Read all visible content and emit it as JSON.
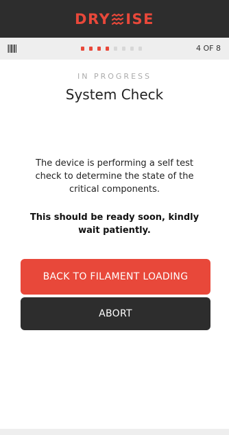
{
  "header": {
    "brand_left": "DRY",
    "brand_right": "ISE",
    "brand_color": "#e8483a",
    "background": "#2d2d2d"
  },
  "progress": {
    "current_step": 4,
    "total_steps": 8,
    "step_label": "4 OF 8",
    "icon": "barcode-icon",
    "active_color": "#e8483a",
    "inactive_color": "#d7d7d7"
  },
  "main": {
    "status": "IN PROGRESS",
    "title": "System Check",
    "description": "The device is performing a self test check to determine the state of the critical components.",
    "wait_note": "This should be ready soon, kindly wait patiently."
  },
  "buttons": {
    "back_label": "BACK TO FILAMENT LOADING",
    "abort_label": "ABORT",
    "back_color": "#e8483a",
    "abort_color": "#2d2d2d"
  }
}
